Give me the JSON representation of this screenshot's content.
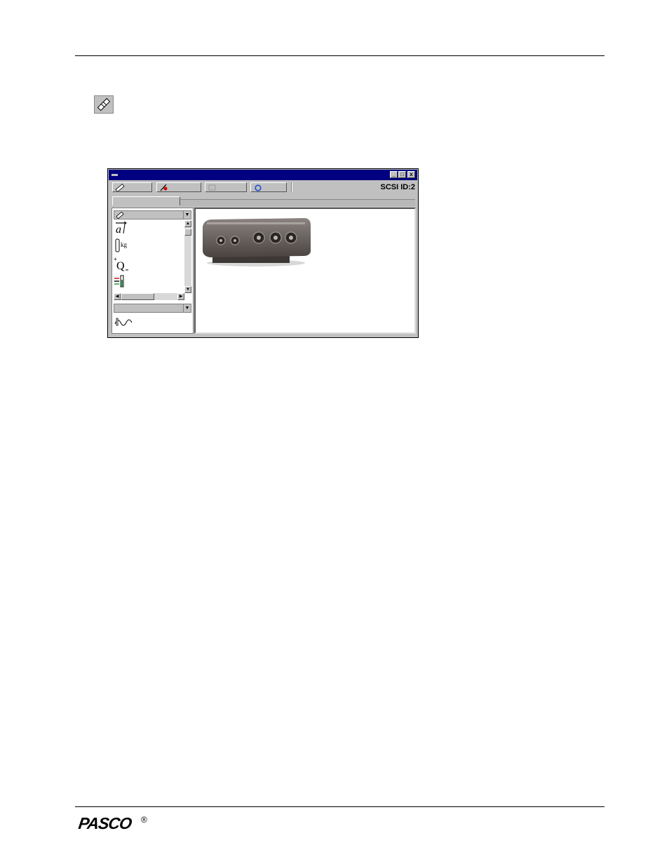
{
  "window": {
    "scsi_label": "SCSI ID:2",
    "title_buttons": [
      "_",
      "□",
      "x"
    ]
  },
  "toolbar": {
    "buttons": [
      {
        "icon": "setup-icon"
      },
      {
        "icon": "record-icon"
      },
      {
        "icon": "monitor-icon"
      },
      {
        "icon": "refresh-icon"
      }
    ]
  },
  "sensor_list": [
    "acceleration-sensor-icon",
    "force-sensor-icon",
    "charge-sensor-icon",
    "temperature-sensor-icon"
  ],
  "instrument_list": [
    "function-generator-icon"
  ],
  "footer": {
    "logo": "PASCO",
    "registered_mark": "®"
  },
  "colors": {
    "titlebar": "#000080",
    "window_face": "#c0c0c0",
    "interface_body": "#5a5350"
  }
}
